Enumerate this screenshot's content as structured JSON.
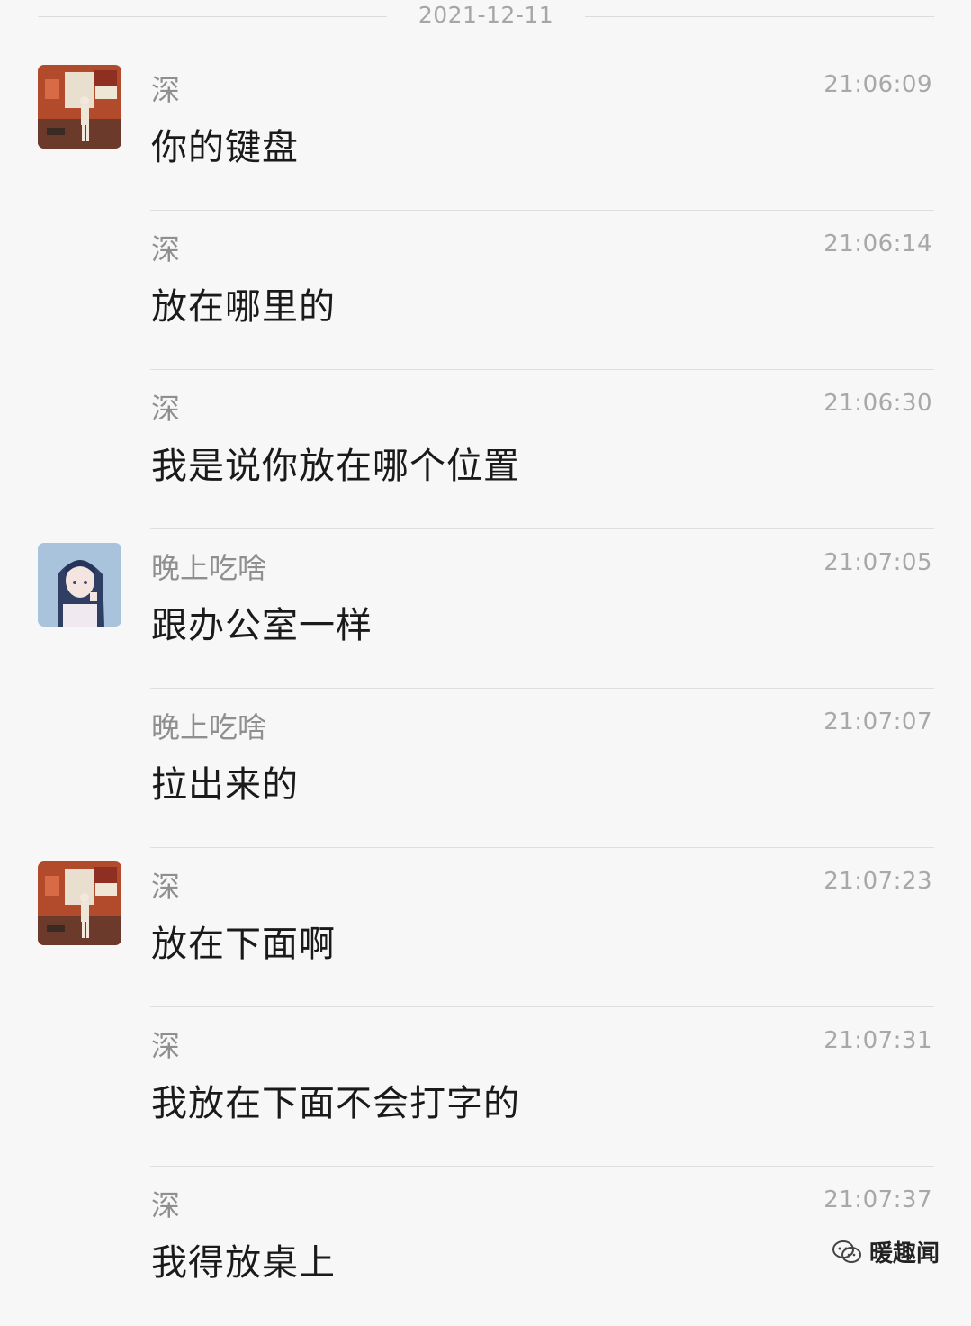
{
  "date_separator": "2021-12-11",
  "messages": [
    {
      "sender": "深",
      "time": "21:06:09",
      "text": "你的键盘",
      "avatar": "user-deep"
    },
    {
      "sender": "深",
      "time": "21:06:14",
      "text": "放在哪里的",
      "avatar": ""
    },
    {
      "sender": "深",
      "time": "21:06:30",
      "text": "我是说你放在哪个位置",
      "avatar": ""
    },
    {
      "sender": "晚上吃啥",
      "time": "21:07:05",
      "text": "跟办公室一样",
      "avatar": "user-girl"
    },
    {
      "sender": "晚上吃啥",
      "time": "21:07:07",
      "text": "拉出来的",
      "avatar": ""
    },
    {
      "sender": "深",
      "time": "21:07:23",
      "text": "放在下面啊",
      "avatar": "user-deep"
    },
    {
      "sender": "深",
      "time": "21:07:31",
      "text": "我放在下面不会打字的",
      "avatar": ""
    },
    {
      "sender": "深",
      "time": "21:07:37",
      "text": "我得放桌上",
      "avatar": ""
    }
  ],
  "watermark": {
    "text": "暖趣闻",
    "icon": "wechat-icon"
  },
  "colors": {
    "background": "#f7f7f7",
    "sender": "#8f8f8f",
    "time": "#a8a8a8",
    "text": "#1a1a1a",
    "divider": "#dedede"
  }
}
